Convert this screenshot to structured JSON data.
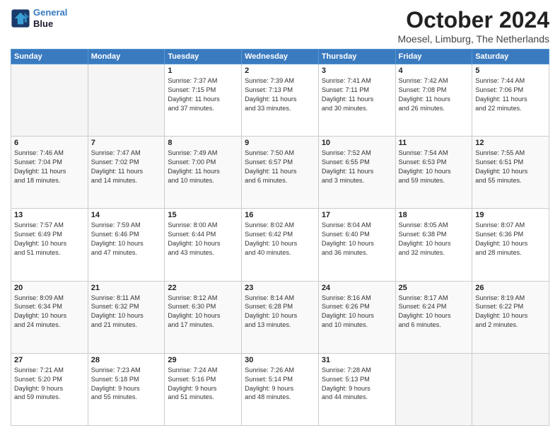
{
  "header": {
    "logo_line1": "General",
    "logo_line2": "Blue",
    "month_title": "October 2024",
    "location": "Moesel, Limburg, The Netherlands"
  },
  "days_of_week": [
    "Sunday",
    "Monday",
    "Tuesday",
    "Wednesday",
    "Thursday",
    "Friday",
    "Saturday"
  ],
  "weeks": [
    [
      {
        "day": "",
        "info": ""
      },
      {
        "day": "",
        "info": ""
      },
      {
        "day": "1",
        "info": "Sunrise: 7:37 AM\nSunset: 7:15 PM\nDaylight: 11 hours\nand 37 minutes."
      },
      {
        "day": "2",
        "info": "Sunrise: 7:39 AM\nSunset: 7:13 PM\nDaylight: 11 hours\nand 33 minutes."
      },
      {
        "day": "3",
        "info": "Sunrise: 7:41 AM\nSunset: 7:11 PM\nDaylight: 11 hours\nand 30 minutes."
      },
      {
        "day": "4",
        "info": "Sunrise: 7:42 AM\nSunset: 7:08 PM\nDaylight: 11 hours\nand 26 minutes."
      },
      {
        "day": "5",
        "info": "Sunrise: 7:44 AM\nSunset: 7:06 PM\nDaylight: 11 hours\nand 22 minutes."
      }
    ],
    [
      {
        "day": "6",
        "info": "Sunrise: 7:46 AM\nSunset: 7:04 PM\nDaylight: 11 hours\nand 18 minutes."
      },
      {
        "day": "7",
        "info": "Sunrise: 7:47 AM\nSunset: 7:02 PM\nDaylight: 11 hours\nand 14 minutes."
      },
      {
        "day": "8",
        "info": "Sunrise: 7:49 AM\nSunset: 7:00 PM\nDaylight: 11 hours\nand 10 minutes."
      },
      {
        "day": "9",
        "info": "Sunrise: 7:50 AM\nSunset: 6:57 PM\nDaylight: 11 hours\nand 6 minutes."
      },
      {
        "day": "10",
        "info": "Sunrise: 7:52 AM\nSunset: 6:55 PM\nDaylight: 11 hours\nand 3 minutes."
      },
      {
        "day": "11",
        "info": "Sunrise: 7:54 AM\nSunset: 6:53 PM\nDaylight: 10 hours\nand 59 minutes."
      },
      {
        "day": "12",
        "info": "Sunrise: 7:55 AM\nSunset: 6:51 PM\nDaylight: 10 hours\nand 55 minutes."
      }
    ],
    [
      {
        "day": "13",
        "info": "Sunrise: 7:57 AM\nSunset: 6:49 PM\nDaylight: 10 hours\nand 51 minutes."
      },
      {
        "day": "14",
        "info": "Sunrise: 7:59 AM\nSunset: 6:46 PM\nDaylight: 10 hours\nand 47 minutes."
      },
      {
        "day": "15",
        "info": "Sunrise: 8:00 AM\nSunset: 6:44 PM\nDaylight: 10 hours\nand 43 minutes."
      },
      {
        "day": "16",
        "info": "Sunrise: 8:02 AM\nSunset: 6:42 PM\nDaylight: 10 hours\nand 40 minutes."
      },
      {
        "day": "17",
        "info": "Sunrise: 8:04 AM\nSunset: 6:40 PM\nDaylight: 10 hours\nand 36 minutes."
      },
      {
        "day": "18",
        "info": "Sunrise: 8:05 AM\nSunset: 6:38 PM\nDaylight: 10 hours\nand 32 minutes."
      },
      {
        "day": "19",
        "info": "Sunrise: 8:07 AM\nSunset: 6:36 PM\nDaylight: 10 hours\nand 28 minutes."
      }
    ],
    [
      {
        "day": "20",
        "info": "Sunrise: 8:09 AM\nSunset: 6:34 PM\nDaylight: 10 hours\nand 24 minutes."
      },
      {
        "day": "21",
        "info": "Sunrise: 8:11 AM\nSunset: 6:32 PM\nDaylight: 10 hours\nand 21 minutes."
      },
      {
        "day": "22",
        "info": "Sunrise: 8:12 AM\nSunset: 6:30 PM\nDaylight: 10 hours\nand 17 minutes."
      },
      {
        "day": "23",
        "info": "Sunrise: 8:14 AM\nSunset: 6:28 PM\nDaylight: 10 hours\nand 13 minutes."
      },
      {
        "day": "24",
        "info": "Sunrise: 8:16 AM\nSunset: 6:26 PM\nDaylight: 10 hours\nand 10 minutes."
      },
      {
        "day": "25",
        "info": "Sunrise: 8:17 AM\nSunset: 6:24 PM\nDaylight: 10 hours\nand 6 minutes."
      },
      {
        "day": "26",
        "info": "Sunrise: 8:19 AM\nSunset: 6:22 PM\nDaylight: 10 hours\nand 2 minutes."
      }
    ],
    [
      {
        "day": "27",
        "info": "Sunrise: 7:21 AM\nSunset: 5:20 PM\nDaylight: 9 hours\nand 59 minutes."
      },
      {
        "day": "28",
        "info": "Sunrise: 7:23 AM\nSunset: 5:18 PM\nDaylight: 9 hours\nand 55 minutes."
      },
      {
        "day": "29",
        "info": "Sunrise: 7:24 AM\nSunset: 5:16 PM\nDaylight: 9 hours\nand 51 minutes."
      },
      {
        "day": "30",
        "info": "Sunrise: 7:26 AM\nSunset: 5:14 PM\nDaylight: 9 hours\nand 48 minutes."
      },
      {
        "day": "31",
        "info": "Sunrise: 7:28 AM\nSunset: 5:13 PM\nDaylight: 9 hours\nand 44 minutes."
      },
      {
        "day": "",
        "info": ""
      },
      {
        "day": "",
        "info": ""
      }
    ]
  ]
}
